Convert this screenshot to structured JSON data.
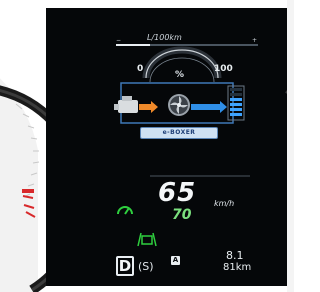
{
  "economy": {
    "unit_label": "L/100km",
    "scale_min": "0",
    "scale_unit": "%",
    "scale_max": "100"
  },
  "hybrid": {
    "badge_label": "e-BOXER"
  },
  "speed": {
    "value": "65",
    "unit": "km/h",
    "set_speed": "70"
  },
  "transmission": {
    "gear": "D",
    "mode": "(S)",
    "auto_badge": "A"
  },
  "trip": {
    "value": "8.1",
    "distance": "81km"
  },
  "colors": {
    "panel": "#050709",
    "cruise_green": "#2fcf3f",
    "set_speed_green": "#7be07e",
    "gauge_red": "#d8292b",
    "flow_orange": "#f08a2a",
    "flow_blue": "#2f8fe8",
    "battery_blue": "#3ea3ff"
  },
  "icons": {
    "engine": "engine-icon",
    "motor": "motor-fan-icon",
    "battery": "battery-level-icon",
    "cruise": "cruise-control-icon",
    "lane": "lane-assist-icon"
  }
}
